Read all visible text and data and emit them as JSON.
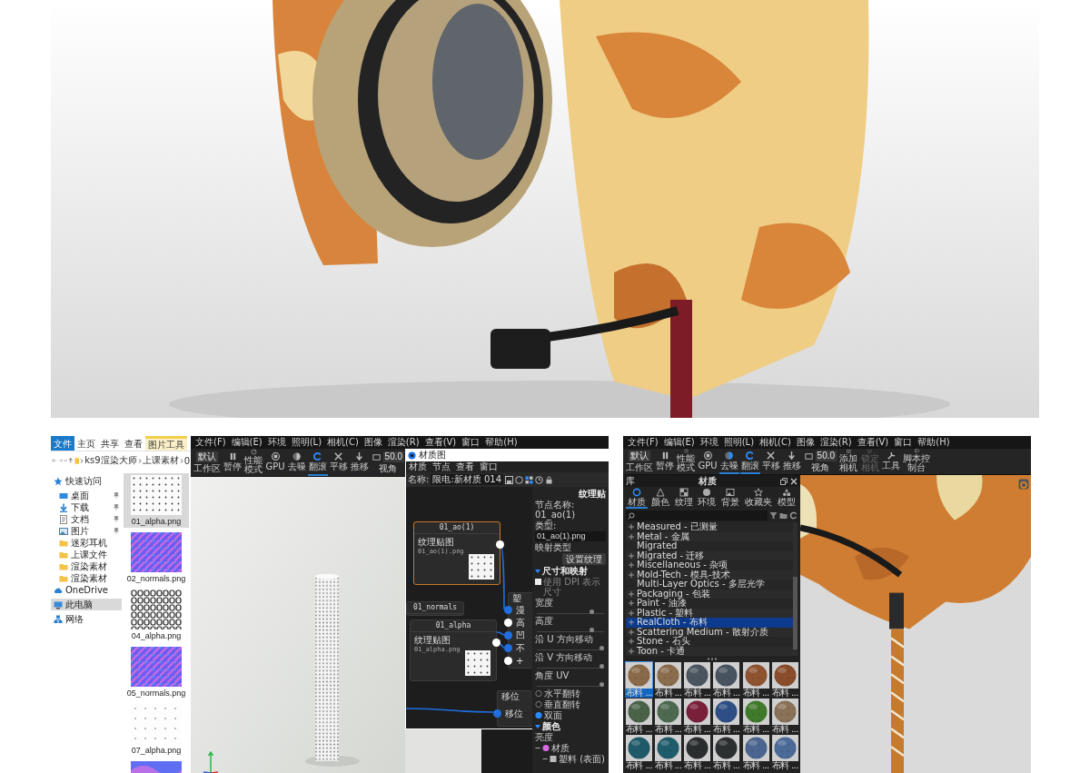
{
  "explorer": {
    "ribbon_tabs": [
      {
        "label": "文件",
        "kind": "file",
        "selected": true
      },
      {
        "label": "主页",
        "kind": "normal",
        "selected": false
      },
      {
        "label": "共享",
        "kind": "normal",
        "selected": false
      },
      {
        "label": "查看",
        "kind": "normal",
        "selected": false
      },
      {
        "label": "图片工具",
        "kind": "contextual",
        "selected": false
      }
    ],
    "breadcrumbs": [
      "ks9渲染大师",
      "上课素材",
      "0"
    ],
    "nav": [
      {
        "label": "快速访问",
        "kind": "star",
        "selected": false,
        "children": [
          {
            "label": "桌面",
            "kind": "desktop",
            "pinned": true,
            "selected": false
          },
          {
            "label": "下载",
            "kind": "download",
            "pinned": true,
            "selected": false
          },
          {
            "label": "文档",
            "kind": "document",
            "pinned": true,
            "selected": false
          },
          {
            "label": "图片",
            "kind": "pictures",
            "pinned": true,
            "selected": false
          },
          {
            "label": "迷彩耳机",
            "kind": "folder",
            "pinned": false,
            "selected": false
          },
          {
            "label": "上课文件",
            "kind": "folder",
            "pinned": false,
            "selected": false
          },
          {
            "label": "渲染素材",
            "kind": "folder",
            "pinned": false,
            "selected": false
          },
          {
            "label": "渲染素材",
            "kind": "folder",
            "pinned": false,
            "selected": false
          }
        ]
      },
      {
        "label": "OneDrive",
        "kind": "cloud",
        "selected": false
      },
      {
        "label": "此电脑",
        "kind": "computer",
        "selected": true
      },
      {
        "label": "网络",
        "kind": "network",
        "selected": false
      }
    ],
    "files": [
      {
        "name": "01_alpha.png",
        "kind": "dots",
        "selected": true
      },
      {
        "name": "02_normals.png",
        "kind": "normals",
        "selected": false
      },
      {
        "name": "04_alpha.png",
        "kind": "links",
        "selected": false
      },
      {
        "name": "05_normals.png",
        "kind": "normals",
        "selected": false
      },
      {
        "name": "07_alpha.png",
        "kind": "sparse",
        "selected": false
      },
      {
        "kind": "waves",
        "selected": false
      }
    ]
  },
  "keyshot_left": {
    "menu": [
      "文件(F)",
      "编辑(E)",
      "环境",
      "照明(L)",
      "相机(C)",
      "图像",
      "渲染(R)",
      "查看(V)",
      "窗口",
      "帮助(H)"
    ],
    "toolbar": [
      {
        "kind": "workspace",
        "value": "默认",
        "label": "工作区",
        "selected": false,
        "disabled": false
      },
      {
        "kind": "pause",
        "label": "暂停",
        "selected": false,
        "disabled": false
      },
      {
        "kind": "perf",
        "label": "性能模式",
        "selected": false,
        "disabled": false
      },
      {
        "kind": "gpu",
        "label": "GPU",
        "selected": false,
        "disabled": false
      },
      {
        "kind": "denoise",
        "label": "去噪",
        "selected": false,
        "disabled": false
      },
      {
        "kind": "tumble",
        "label": "翻滚",
        "selected": true,
        "disabled": false
      },
      {
        "kind": "pan",
        "label": "平移",
        "selected": false,
        "disabled": false
      },
      {
        "kind": "dolly",
        "label": "推移",
        "selected": false,
        "disabled": false
      },
      {
        "kind": "fov",
        "value": "50.0",
        "label": "视角",
        "selected": false,
        "disabled": false
      }
    ],
    "material_graph": {
      "title": "材质图",
      "menu": [
        "材质",
        "节点",
        "查看",
        "窗口"
      ],
      "name_label": "名称:",
      "name_value": "限电:新材质 014",
      "nodes": [
        {
          "kind": "texture",
          "header": "01_ao(1)",
          "title": "纹理贴图",
          "file": "01_ao(1).png",
          "selected": true
        },
        {
          "kind": "collapsed",
          "header": "01_normals",
          "selected": false
        },
        {
          "kind": "texture",
          "header": "01_alpha",
          "title": "纹理贴图",
          "file": "01_alpha.png",
          "selected": false
        },
        {
          "kind": "material",
          "header": "塑",
          "selected": false,
          "ports": [
            {
              "label": "漫",
              "connected": true
            },
            {
              "label": "高",
              "connected": false
            },
            {
              "label": "凹",
              "connected": true
            },
            {
              "label": "不",
              "connected": true
            },
            {
              "label": "+",
              "connected": false
            }
          ]
        },
        {
          "kind": "shift",
          "header": "移位",
          "selected": false,
          "ports": [
            {
              "label": "移位",
              "connected": true
            }
          ]
        }
      ],
      "properties": {
        "title": "纹理贴",
        "rows": [
          {
            "kind": "text",
            "label": "节点名称: 01_ao(1)"
          },
          {
            "kind": "text",
            "label": "类型:"
          },
          {
            "kind": "field",
            "value": "01_ao(1).png"
          },
          {
            "kind": "text",
            "label": "映射类型"
          },
          {
            "kind": "button",
            "label": "设置纹理"
          },
          {
            "kind": "section",
            "label": "尺寸和映射"
          },
          {
            "kind": "checkbox",
            "label": "使用 DPI 表示尺寸",
            "checked": false
          },
          {
            "kind": "slider",
            "label": "宽度",
            "level": 0.85
          },
          {
            "kind": "slider",
            "label": "高度",
            "level": 0.85
          },
          {
            "kind": "slider",
            "label": "沿 U 方向移动",
            "level": 1
          },
          {
            "kind": "slider",
            "label": "沿 V 方向移动",
            "level": 1
          },
          {
            "kind": "slider",
            "label": "角度 UV",
            "level": 1
          },
          {
            "kind": "radio",
            "label": "水平翻转",
            "checked": false
          },
          {
            "kind": "radio",
            "label": "垂直翻转",
            "checked": false
          },
          {
            "kind": "radio",
            "label": "双面",
            "checked": true
          },
          {
            "kind": "section",
            "label": "颜色"
          },
          {
            "kind": "text",
            "label": "亮度"
          },
          {
            "kind": "tree",
            "label": "材质",
            "expanded": true,
            "children": [
              {
                "kind": "tree",
                "label": "塑料 (表面)",
                "expanded": true
              }
            ]
          }
        ]
      }
    }
  },
  "keyshot_right": {
    "menu": [
      "文件(F)",
      "编辑(E)",
      "环境",
      "照明(L)",
      "相机(C)",
      "图像",
      "渲染(R)",
      "查看(V)",
      "窗口",
      "帮助(H)"
    ],
    "toolbar": [
      {
        "kind": "workspace",
        "value": "默认",
        "label": "工作区",
        "selected": false,
        "disabled": false
      },
      {
        "kind": "pause",
        "label": "暂停",
        "selected": false,
        "disabled": false
      },
      {
        "kind": "perf",
        "label": "性能模式",
        "selected": false,
        "disabled": false
      },
      {
        "kind": "gpu",
        "label": "GPU",
        "selected": false,
        "disabled": false
      },
      {
        "kind": "denoise",
        "label": "去噪",
        "selected": true,
        "disabled": false
      },
      {
        "kind": "tumble",
        "label": "翻滚",
        "selected": true,
        "disabled": false
      },
      {
        "kind": "pan",
        "label": "平移",
        "selected": false,
        "disabled": false
      },
      {
        "kind": "dolly",
        "label": "推移",
        "selected": false,
        "disabled": false
      },
      {
        "kind": "fov",
        "value": "50.0",
        "label": "视角",
        "selected": false,
        "disabled": false
      },
      {
        "kind": "camera_add",
        "label": "添加相机",
        "selected": false,
        "disabled": false
      },
      {
        "kind": "camera_lock",
        "label": "锁定相机",
        "selected": false,
        "disabled": true
      },
      {
        "kind": "tools",
        "label": "工具",
        "selected": false,
        "disabled": false
      },
      {
        "kind": "console",
        "label": "脚本控制台",
        "selected": false,
        "disabled": false
      }
    ],
    "library": {
      "title": "库",
      "panel_title": "材质",
      "tabs": [
        {
          "label": "材质",
          "kind": "material",
          "selected": true
        },
        {
          "label": "颜色",
          "kind": "color",
          "selected": false
        },
        {
          "label": "纹理",
          "kind": "texture",
          "selected": false
        },
        {
          "label": "环境",
          "kind": "environment",
          "selected": false
        },
        {
          "label": "背景",
          "kind": "background",
          "selected": false
        },
        {
          "label": "收藏夹",
          "kind": "favorites",
          "selected": false
        },
        {
          "label": "模型",
          "kind": "model",
          "selected": false
        }
      ],
      "categories": [
        {
          "label": "Measured - 已测量",
          "expandable": true,
          "selected": false
        },
        {
          "label": "Metal - 金属",
          "expandable": true,
          "selected": false
        },
        {
          "label": "Migrated",
          "expandable": false,
          "selected": false
        },
        {
          "label": "Migrated - 迁移",
          "expandable": true,
          "selected": false
        },
        {
          "label": "Miscellaneous - 杂项",
          "expandable": true,
          "selected": false
        },
        {
          "label": "Mold-Tech - 模具-技术",
          "expandable": true,
          "selected": false
        },
        {
          "label": "Multi-Layer Optics - 多层光学",
          "expandable": false,
          "selected": false
        },
        {
          "label": "Packaging - 包装",
          "expandable": true,
          "selected": false
        },
        {
          "label": "Paint - 油漆",
          "expandable": true,
          "selected": false
        },
        {
          "label": "Plastic - 塑料",
          "expandable": true,
          "selected": false
        },
        {
          "label": "RealCloth - 布料",
          "expandable": true,
          "selected": true
        },
        {
          "label": "Scattering Medium - 散射介质",
          "expandable": true,
          "selected": false
        },
        {
          "label": "Stone - 石头",
          "expandable": true,
          "selected": false
        },
        {
          "label": "Toon - 卡通",
          "expandable": true,
          "selected": false
        }
      ],
      "swatches": [
        {
          "label": "布料 ...",
          "selected": true
        },
        {
          "label": "布料 ...",
          "selected": false
        },
        {
          "label": "布料 ...",
          "selected": false
        },
        {
          "label": "布料 ...",
          "selected": false
        },
        {
          "label": "布料 ...",
          "selected": false
        },
        {
          "label": "布料 ...",
          "selected": false
        },
        {
          "label": "布料 ...",
          "selected": false
        },
        {
          "label": "布料 ...",
          "selected": false
        },
        {
          "label": "布料 ...",
          "selected": false
        },
        {
          "label": "布料 ...",
          "selected": false
        },
        {
          "label": "布料 ...",
          "selected": false
        },
        {
          "label": "布料 ...",
          "selected": false
        },
        {
          "label": "布料 ...",
          "selected": false
        },
        {
          "label": "布料 ...",
          "selected": false
        },
        {
          "label": "布料 ...",
          "selected": false
        },
        {
          "label": "布料 ...",
          "selected": false
        },
        {
          "label": "布料 ...",
          "selected": false
        },
        {
          "label": "布料 ...",
          "selected": false
        }
      ]
    }
  }
}
